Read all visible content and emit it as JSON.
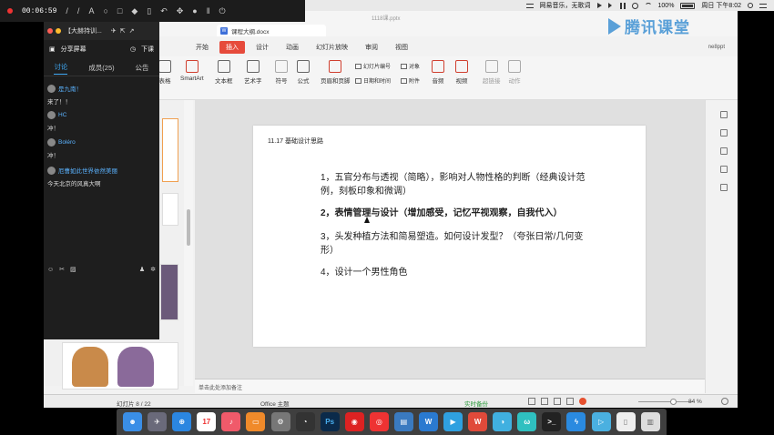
{
  "menubar": {
    "music_title": "网易音乐，无歌词",
    "battery": "100%",
    "clock": "周日 下午8:02"
  },
  "livebar": {
    "elapsed": "00:06:59"
  },
  "ppt_window": {
    "file_title": "1118课.pptx",
    "doc_tab_label": "课程大纲.docx",
    "tabs": [
      "开始",
      "插入",
      "设计",
      "动画",
      "幻灯片放映",
      "审阅",
      "视图"
    ],
    "active_tab": "插入",
    "user": "ne8ppt"
  },
  "ribbon": {
    "items": [
      {
        "label": "表格"
      },
      {
        "label": "SmartArt"
      },
      {
        "label": "文本框"
      },
      {
        "label": "艺术字"
      },
      {
        "label": "符号"
      },
      {
        "label": "公式"
      },
      {
        "label": "页眉和页脚"
      },
      {
        "label": "音频"
      },
      {
        "label": "视频"
      },
      {
        "label": "超链接"
      },
      {
        "label": "动作"
      }
    ],
    "small_items": [
      "幻灯片编号",
      "对象",
      "日期和时间",
      "附件"
    ]
  },
  "slide": {
    "header": "11.17   基础设计思路",
    "items": [
      "1，五官分布与透视（简略），影响对人物性格的判断（经典设计范例，刻板印象和微调）",
      "2，表情管理与设计（增加感受，记忆平视观察，自我代入）",
      "3，头发种植方法和简易塑造。如何设计发型？（夸张日常/几何变形）",
      "4，设计一个男性角色"
    ]
  },
  "notes_placeholder": "单击此处添加备注",
  "statusbar": {
    "slide_counter": "幻灯片 8 / 22",
    "theme": "Office 主题",
    "backup": "实时备份",
    "zoom": "84 %"
  },
  "chat": {
    "window_title": "【大赫持训...",
    "share_label": "分享屏幕",
    "class_end": "下课",
    "tabs": [
      "讨论",
      "成员(25)",
      "公告"
    ],
    "active_tab": "讨论",
    "messages": [
      {
        "user": "是九南！",
        "text": "来了！！"
      },
      {
        "user": "HC",
        "text": "冲！"
      },
      {
        "user": "Boléro",
        "text": "冲！"
      },
      {
        "user": "厄曹如此世界依然美丽",
        "text": "今天北京的风真大啊"
      }
    ]
  },
  "brand": {
    "name": "腾讯课堂"
  },
  "dock": {
    "apps": [
      "Finder",
      "Launchpad",
      "Safari",
      "Calendar",
      "Music",
      "Books",
      "Preferences",
      "QQ",
      "Photoshop",
      "NetEase",
      "WPS",
      "Trash"
    ],
    "calendar_date": "17"
  }
}
